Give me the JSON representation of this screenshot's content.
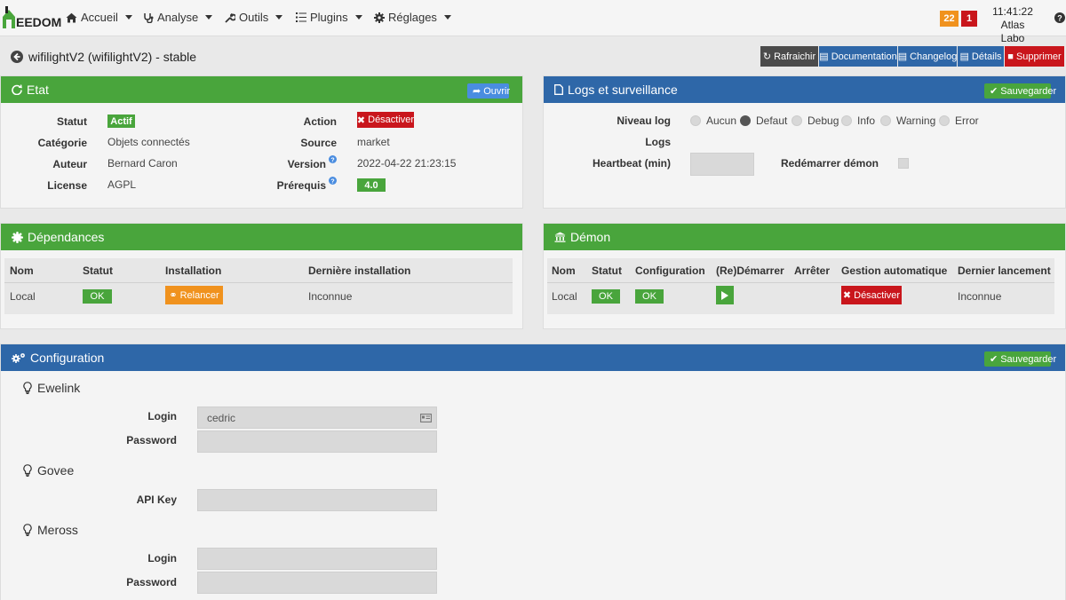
{
  "navbar": {
    "logo_text": "EEDOM",
    "menu": [
      "Accueil",
      "Analyse",
      "Outils",
      "Plugins",
      "Réglages"
    ],
    "badge_orange": "22",
    "badge_red": "1",
    "time": "11:41:22",
    "user": "Atlas Labo"
  },
  "page": {
    "title": "wifilightV2 (wifilightV2) - stable",
    "buttons": {
      "refresh": "Rafraichir",
      "docs": "Documentation",
      "changelog": "Changelog",
      "details": "Détails",
      "delete": "Supprimer"
    }
  },
  "etat": {
    "title": "Etat",
    "open_btn": "Ouvrir",
    "statut_label": "Statut",
    "statut_value": "Actif",
    "categorie_label": "Catégorie",
    "categorie_value": "Objets connectés",
    "auteur_label": "Auteur",
    "auteur_value": "Bernard Caron",
    "license_label": "License",
    "license_value": "AGPL",
    "action_label": "Action",
    "action_value": "Désactiver",
    "source_label": "Source",
    "source_value": "market",
    "version_label": "Version",
    "version_value": "2022-04-22 21:23:15",
    "prereq_label": "Prérequis",
    "prereq_value": "4.0"
  },
  "logs": {
    "title": "Logs et surveillance",
    "save_btn": "Sauvegarder",
    "niveau_label": "Niveau log",
    "levels": [
      "Aucun",
      "Defaut",
      "Debug",
      "Info",
      "Warning",
      "Error"
    ],
    "selected_level": "Defaut",
    "logs_label": "Logs",
    "heartbeat_label": "Heartbeat (min)",
    "restart_label": "Redémarrer démon"
  },
  "deps": {
    "title": "Dépendances",
    "headers": [
      "Nom",
      "Statut",
      "Installation",
      "Dernière installation"
    ],
    "row": {
      "nom": "Local",
      "statut": "OK",
      "installation": "Relancer",
      "derniere": "Inconnue"
    }
  },
  "demon": {
    "title": "Démon",
    "headers": [
      "Nom",
      "Statut",
      "Configuration",
      "(Re)Démarrer",
      "Arrêter",
      "Gestion automatique",
      "Dernier lancement"
    ],
    "row": {
      "nom": "Local",
      "statut": "OK",
      "config": "OK",
      "gestion": "Désactiver",
      "dernier": "Inconnue"
    }
  },
  "config": {
    "title": "Configuration",
    "save_btn": "Sauvegarder",
    "ewelink_title": "Ewelink",
    "ewelink_login_label": "Login",
    "ewelink_login_value": "cedric",
    "ewelink_password_label": "Password",
    "govee_title": "Govee",
    "govee_api_label": "API Key",
    "meross_title": "Meross",
    "meross_login_label": "Login",
    "meross_password_label": "Password"
  },
  "colors": {
    "green": "#49a53c",
    "blue": "#2e67a8",
    "red": "#c9161c",
    "orange": "#f0921e",
    "dark": "#4b4b4b"
  }
}
